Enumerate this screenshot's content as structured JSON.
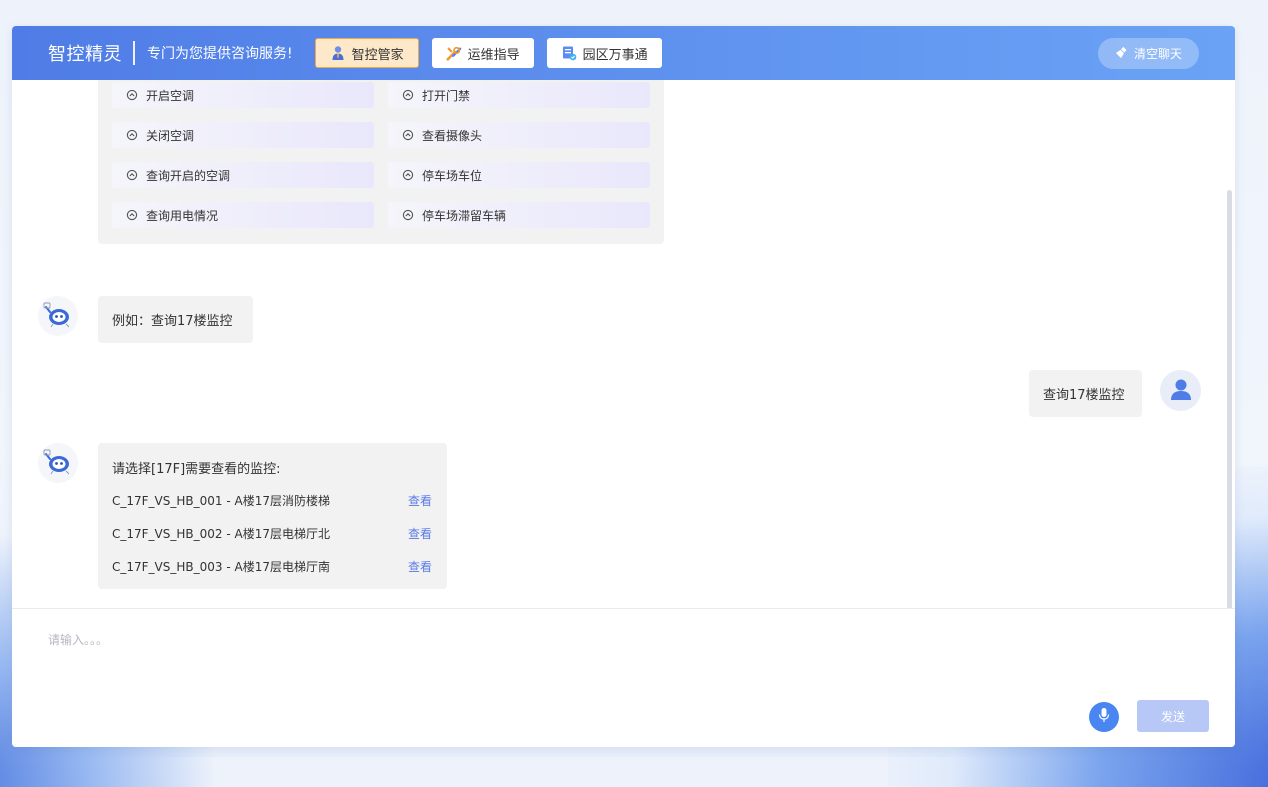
{
  "header": {
    "brand": "智控精灵",
    "tagline": "专门为您提供咨询服务!",
    "tabs": [
      {
        "label": "智控管家",
        "active": true
      },
      {
        "label": "运维指导",
        "active": false
      },
      {
        "label": "园区万事通",
        "active": false
      }
    ],
    "clear_label": "清空聊天"
  },
  "commands": {
    "left": [
      "开启空调",
      "关闭空调",
      "查询开启的空调",
      "查询用电情况"
    ],
    "right": [
      "打开门禁",
      "查看摄像头",
      "停车场车位",
      "停车场滞留车辆"
    ]
  },
  "messages": {
    "bot_example": "例如：查询17楼监控",
    "user_query": "查询17楼监控",
    "bot_reply": {
      "title": "请选择[17F]需要查看的监控:",
      "rows": [
        {
          "camera": "C_17F_VS_HB_001 - A楼17层消防楼梯",
          "action": "查看"
        },
        {
          "camera": "C_17F_VS_HB_002 - A楼17层电梯厅北",
          "action": "查看"
        },
        {
          "camera": "C_17F_VS_HB_003 - A楼17层电梯厅南",
          "action": "查看"
        }
      ]
    }
  },
  "input": {
    "placeholder": "请输入。。。",
    "send_label": "发送"
  },
  "colors": {
    "header_start": "#4f7ce6",
    "header_end": "#6aa3f5",
    "active_tab_bg": "#fde9c9",
    "active_tab_border": "#f1a84a",
    "link": "#5b7be6",
    "send_disabled": "#b7c8f7",
    "mic": "#4a86f2"
  },
  "icons": {
    "tab_icons": [
      "butler-person-icon",
      "tools-icon",
      "document-check-icon"
    ],
    "command_icon": "cloud-chevron-icon",
    "clear_icon": "broom-icon",
    "bot_avatar": "robot-avatar-icon",
    "user_avatar": "user-avatar-icon",
    "mic_icon": "microphone-icon"
  }
}
